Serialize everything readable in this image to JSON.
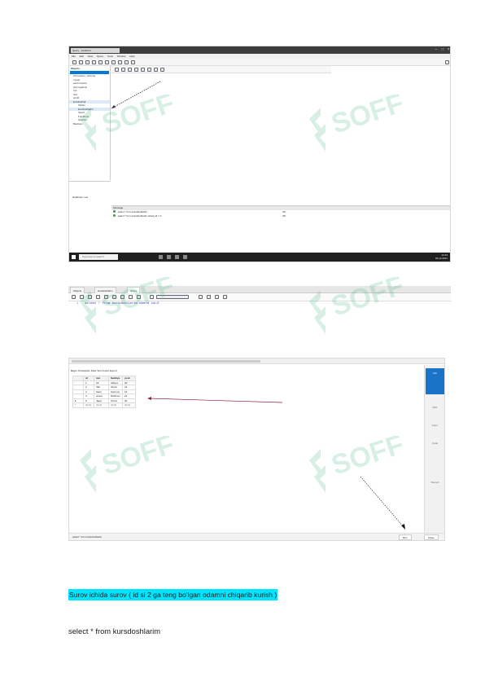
{
  "document": {
    "highlighted_heading": "Surov ichida surov ( id si 2 ga teng bo'lgan odamni chiqarib kurish )",
    "sql_statement": "select * from kursdoshlarim"
  },
  "colors": {
    "highlight": "#00e5ff",
    "watermark": "#3cb878",
    "arrow": "#8b1a4a",
    "accent": "#1a73c7"
  },
  "screenshot1": {
    "tab_title": "Query - localhost",
    "menu": "File Edit View Query Tools Window Help",
    "sidebar_header": "Objects",
    "sidebar_items": [
      "information_schema",
      "mysql",
      "performance",
      "phpmyadmin",
      "sys",
      "test",
      "world",
      "kursdoshlar",
      "Tables",
      "kursdoshlarim",
      "Views",
      "Functions",
      "Queries",
      "Backups"
    ],
    "database_label": "Database: test",
    "output_header": "Message",
    "output_rows": [
      {
        "query": "select * from kursdoshlarim",
        "result": "OK"
      },
      {
        "query": "select * from kursdoshlarim where id = 2",
        "result": "OK"
      }
    ],
    "taskbar_search": "Type here to search",
    "clock_time": "12:44",
    "clock_date": "03.12.2021"
  },
  "screenshot2": {
    "tabs": [
      "Objects",
      "kursdoshlarim",
      "Query"
    ],
    "line_number": "1",
    "code": "select * from kursdoshlarim where id=2"
  },
  "screenshot3": {
    "toolbar": "Begin Transaction   Filter   Sort   Import   Export",
    "columns": [
      "id",
      "ism",
      "familiya",
      "yosh"
    ],
    "rows": [
      [
        "1",
        "Ali",
        "Valiyev",
        "20"
      ],
      [
        "2",
        "Vali",
        "Aliyev",
        "21"
      ],
      [
        "3",
        "Sami",
        "Karimov",
        "19"
      ],
      [
        "4",
        "Anvar",
        "Rahimov",
        "22"
      ],
      [
        "5",
        "Jasur",
        "Toirov",
        "20"
      ]
    ],
    "null_row": [
      "(Null)",
      "(Null)",
      "(Null)",
      "(Null)"
    ],
    "side_labels": [
      "Info",
      "DDL",
      "Form",
      "Code",
      "Record"
    ],
    "footer_text": "select * from kursdoshlarim",
    "footer_buttons": [
      "Run",
      "Close"
    ]
  }
}
